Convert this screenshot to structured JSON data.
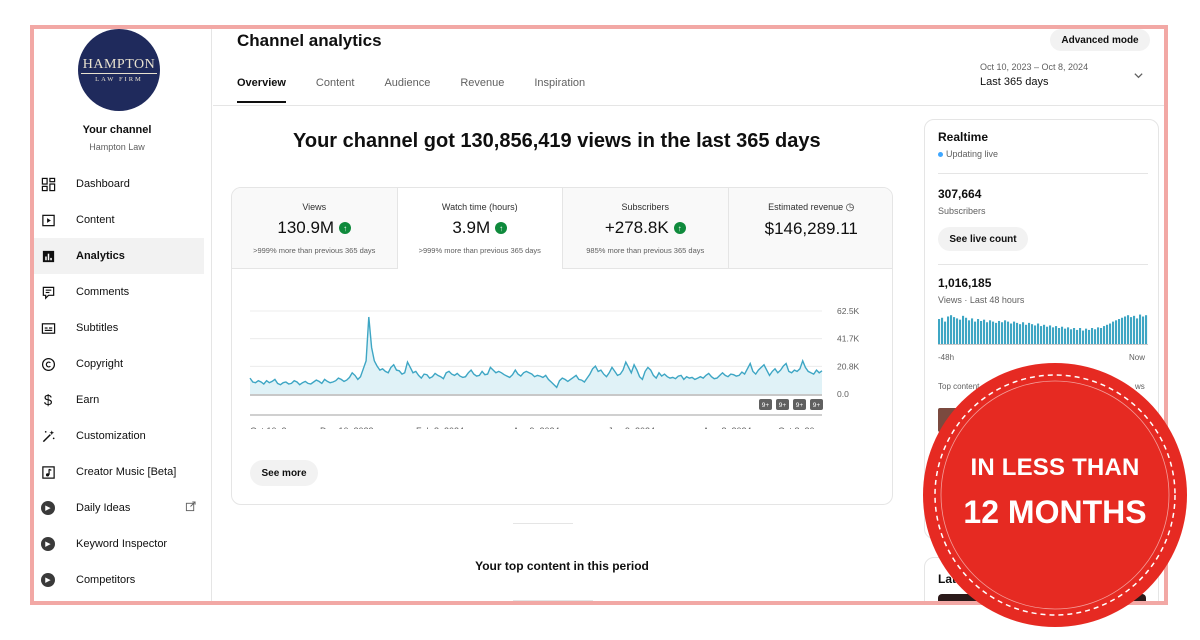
{
  "brand": {
    "logo_line1": "HAMPTON",
    "logo_line2": "LAW FIRM"
  },
  "sidebar": {
    "title": "Your channel",
    "subtitle": "Hampton Law",
    "items": [
      {
        "label": "Dashboard",
        "icon": "dashboard-icon"
      },
      {
        "label": "Content",
        "icon": "content-icon"
      },
      {
        "label": "Analytics",
        "icon": "analytics-icon"
      },
      {
        "label": "Comments",
        "icon": "comments-icon"
      },
      {
        "label": "Subtitles",
        "icon": "subtitles-icon"
      },
      {
        "label": "Copyright",
        "icon": "copyright-icon"
      },
      {
        "label": "Earn",
        "icon": "dollar-icon"
      },
      {
        "label": "Customization",
        "icon": "magic-wand-icon"
      },
      {
        "label": "Creator Music [Beta]",
        "icon": "music-icon"
      },
      {
        "label": "Daily Ideas",
        "icon": "plugin-icon"
      },
      {
        "label": "Keyword Inspector",
        "icon": "plugin-icon"
      },
      {
        "label": "Competitors",
        "icon": "plugin-icon"
      }
    ]
  },
  "header": {
    "title": "Channel analytics",
    "advanced_label": "Advanced mode",
    "date_range": "Oct 10, 2023 – Oct 8, 2024",
    "date_label": "Last 365 days"
  },
  "tabs": [
    "Overview",
    "Content",
    "Audience",
    "Revenue",
    "Inspiration"
  ],
  "headline": "Your channel got 130,856,419 views in the last 365 days",
  "metrics": [
    {
      "label": "Views",
      "value": "130.9M",
      "sub": ">999% more than previous 365 days"
    },
    {
      "label": "Watch time (hours)",
      "value": "3.9M",
      "sub": ">999% more than previous 365 days"
    },
    {
      "label": "Subscribers",
      "value": "+278.8K",
      "sub": "985% more than previous 365 days"
    },
    {
      "label": "Estimated revenue",
      "value": "$146,289.11"
    }
  ],
  "see_more": "See more",
  "top_content": "Your top content in this period",
  "realtime": {
    "title": "Realtime",
    "live": "Updating live",
    "subs_value": "307,664",
    "subs_label": "Subscribers",
    "live_button": "See live count",
    "views_value": "1,016,185",
    "views_label": "Views · Last 48 hours",
    "axis_start": "-48h",
    "axis_end": "Now",
    "top_content": "Top content",
    "views_col": "ws",
    "latest": "Lat"
  },
  "realtime_bars": [
    0.78,
    0.82,
    0.7,
    0.86,
    0.9,
    0.84,
    0.8,
    0.76,
    0.88,
    0.82,
    0.74,
    0.8,
    0.7,
    0.78,
    0.72,
    0.76,
    0.68,
    0.74,
    0.7,
    0.66,
    0.72,
    0.68,
    0.74,
    0.7,
    0.64,
    0.7,
    0.66,
    0.62,
    0.68,
    0.6,
    0.66,
    0.62,
    0.58,
    0.64,
    0.56,
    0.6,
    0.54,
    0.58,
    0.52,
    0.56,
    0.5,
    0.54,
    0.48,
    0.52,
    0.46,
    0.5,
    0.44,
    0.5,
    0.42,
    0.48,
    0.44,
    0.5,
    0.46,
    0.52,
    0.5,
    0.56,
    0.6,
    0.64,
    0.7,
    0.74,
    0.78,
    0.82,
    0.86,
    0.9,
    0.84,
    0.88,
    0.8,
    0.92,
    0.86,
    0.9
  ],
  "stamp": {
    "line1": "IN LESS THAN",
    "line2": "12 MONTHS",
    "color": "#e62a22"
  },
  "chart_data": {
    "type": "area",
    "title": "",
    "x_ticks": [
      "Oct 10, 2...",
      "Dec 10, 2023",
      "Feb 8, 2024",
      "Apr 9, 2024",
      "Jun 9, 2024",
      "Aug 8, 2024",
      "Oct 8, 20..."
    ],
    "y_ticks": [
      "62.5K",
      "41.7K",
      "20.8K",
      "0.0"
    ],
    "ylim": [
      0,
      62500
    ],
    "series": [
      {
        "values": [
          12000,
          9000,
          8500,
          10000,
          9000,
          7500,
          10000,
          8500,
          9500,
          11000,
          8000,
          7000,
          8500,
          9000,
          7500,
          8000,
          10000,
          9000,
          7000,
          8500,
          9500,
          8000,
          7500,
          9000,
          10500,
          9500,
          8000,
          11000,
          9500,
          8500,
          9000,
          10000,
          12000,
          11000,
          9500,
          10500,
          12500,
          16000,
          14000,
          11000,
          13000,
          19000,
          25000,
          58000,
          35000,
          25000,
          21000,
          18000,
          19000,
          17000,
          16000,
          20000,
          22000,
          18000,
          17500,
          15000,
          16000,
          24000,
          20000,
          16000,
          17000,
          14000,
          12000,
          15000,
          14500,
          12000,
          13000,
          15500,
          14000,
          13000,
          11500,
          16000,
          17000,
          15000,
          14000,
          15500,
          13500,
          12500,
          13000,
          16000,
          18000,
          15000,
          13500,
          14000,
          17000,
          14500,
          15000,
          20000,
          18000,
          16000,
          17000,
          16000,
          14500,
          13500,
          12500,
          14500,
          18000,
          15000,
          13500,
          16000,
          17000,
          16000,
          15000,
          13000,
          14000,
          13500,
          12500,
          14000,
          11000,
          9000,
          7000,
          5000,
          10000,
          12000,
          11000,
          9500,
          11000,
          12500,
          14000,
          11000,
          10500,
          9000,
          12000,
          15000,
          19000,
          21000,
          17000,
          18000,
          15000,
          13000,
          16000,
          20000,
          17000,
          14000,
          15000,
          18000,
          24000,
          20000,
          16000,
          22000,
          18000,
          13000,
          11000,
          17000,
          20000,
          18000,
          14000,
          12000,
          16000,
          13500,
          15000,
          13000,
          12000,
          12500,
          11500,
          13500,
          14000,
          11000,
          13000,
          12000,
          12500,
          11000,
          12000,
          13000,
          12000,
          14000,
          15500,
          13000,
          11500,
          12000,
          14000,
          16000,
          14000,
          13000,
          15000,
          14500,
          13500,
          14000,
          16500,
          15000,
          19000,
          23000,
          17000,
          15000,
          18000,
          20000,
          22000,
          18000,
          14000,
          17000,
          19000,
          16000,
          18000,
          21000,
          23000,
          17000,
          16000,
          18000,
          17000,
          19000,
          25000,
          20000,
          17000,
          16000,
          15000,
          18000,
          16000,
          17500
        ]
      }
    ],
    "legend_badges": [
      "9+",
      "9+",
      "9+",
      "9+"
    ],
    "line_color": "#3ea6c4",
    "fill_color": "#e0f2f7"
  }
}
